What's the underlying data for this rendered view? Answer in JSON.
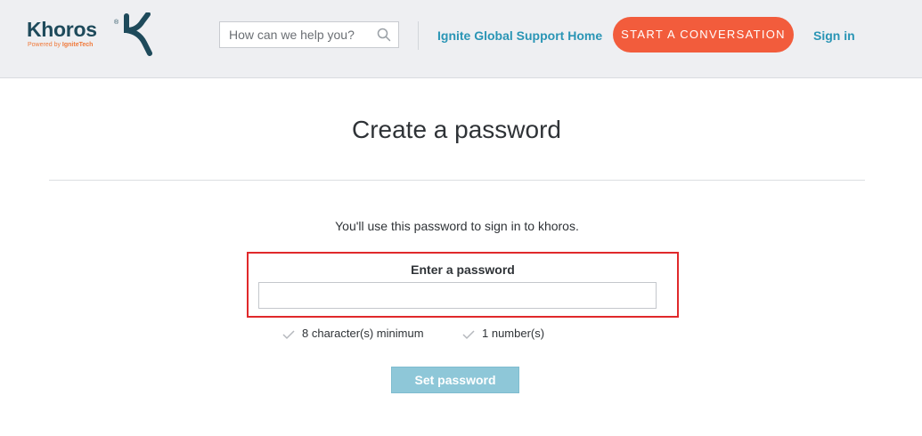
{
  "header": {
    "logo": {
      "wordmark": "Khoros",
      "registered_mark": "®",
      "tagline_prefix": "Powered by ",
      "tagline_brand": "IgniteTech"
    },
    "search": {
      "placeholder": "How can we help you?"
    },
    "nav_home_label": "Ignite Global Support Home",
    "cta_label": "START A CONVERSATION",
    "signin_label": "Sign in"
  },
  "main": {
    "title": "Create a password",
    "subtitle": "You'll use this password to sign in to khoros.",
    "password_field": {
      "label": "Enter a password",
      "value": ""
    },
    "requirements": [
      {
        "label": "8 character(s) minimum",
        "met": false
      },
      {
        "label": "1 number(s)",
        "met": false
      }
    ],
    "submit_label": "Set password"
  },
  "colors": {
    "brand_dark": "#1e4a5b",
    "brand_orange": "#f07a3b",
    "link": "#2a95b5",
    "cta": "#f25c3c",
    "highlight_border": "#e0292b",
    "button_disabled": "#8ec7d8"
  },
  "icons": {
    "search": "search-icon",
    "check": "check-icon",
    "logo_mark": "khoros-k-icon"
  }
}
